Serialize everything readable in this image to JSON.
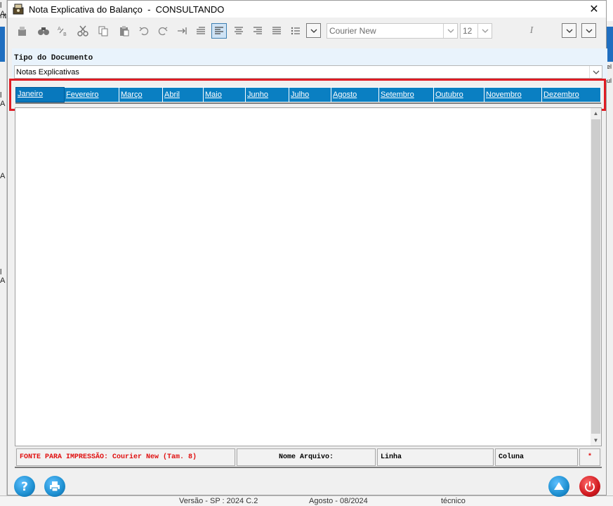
{
  "background": {
    "left_fragments": [
      "l A",
      "nto",
      "l A",
      "A",
      "l A"
    ],
    "right_fragments": [
      "el",
      "ul"
    ],
    "bottom_texts": [
      "Versão - SP : 2024 C.2",
      "Agosto - 08/2024",
      "técnico"
    ]
  },
  "window": {
    "title": "Nota Explicativa do Balanço  -  CONSULTANDO",
    "close_glyph": "✕"
  },
  "toolbar": {
    "font_name": "Courier New",
    "font_size": "12",
    "italic_label": "I"
  },
  "document": {
    "type_label": "Tipo do Documento",
    "type_value": "Notas Explicativas"
  },
  "months": [
    "Janeiro",
    "Fevereiro",
    "Março",
    "Abril",
    "Maio",
    "Junho",
    "Julho",
    "Agosto",
    "Setembro",
    "Outubro",
    "Novembro",
    "Dezembro"
  ],
  "active_month_index": 0,
  "status": {
    "print_font": "FONTE PARA IMPRESSÃO: Courier New (Tam. 8)",
    "file_name_label": "Nome Arquivo:",
    "line_label": "Linha",
    "column_label": "Coluna",
    "marker": "*"
  },
  "colors": {
    "tab_blue": "#0a7fc2",
    "highlight_red": "#e01c24",
    "help_blue": "#1d8fd0",
    "power_red": "#d0191f"
  }
}
